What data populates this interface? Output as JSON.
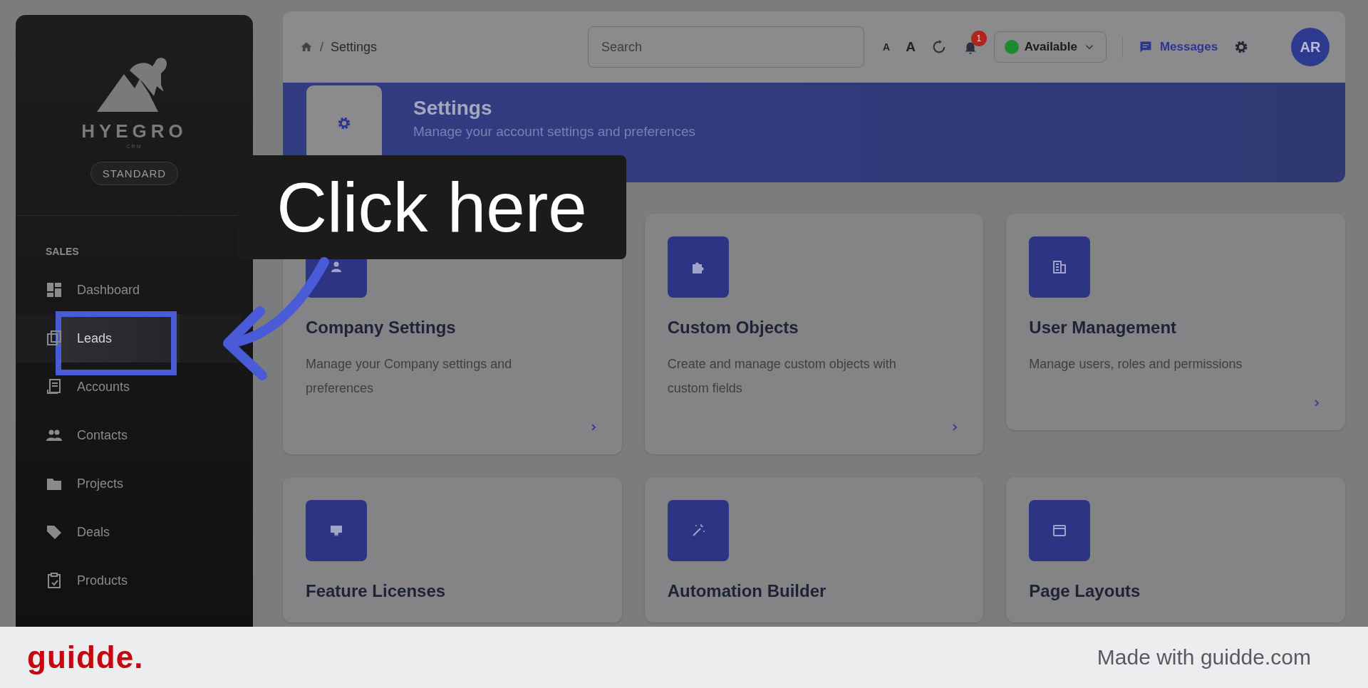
{
  "sidebar": {
    "logo": {
      "name": "HYEGRO",
      "tagline": "CRM"
    },
    "plan": "STANDARD",
    "section": "SALES",
    "items": [
      {
        "label": "Dashboard",
        "selected": false
      },
      {
        "label": "Leads",
        "selected": true
      },
      {
        "label": "Accounts",
        "selected": false
      },
      {
        "label": "Contacts",
        "selected": false
      },
      {
        "label": "Projects",
        "selected": false
      },
      {
        "label": "Deals",
        "selected": false
      },
      {
        "label": "Products",
        "selected": false
      }
    ]
  },
  "header": {
    "breadcrumb": "Settings",
    "separator": "/",
    "search": {
      "placeholder": "Search"
    },
    "font_small": "A",
    "font_large": "A",
    "notifications": "1",
    "status": "Available",
    "messages": "Messages",
    "avatar": "AR"
  },
  "banner": {
    "title": "Settings",
    "subtitle": "Manage your account settings and preferences"
  },
  "cards": [
    {
      "title": "Company Settings",
      "description": "Manage your Company settings and preferences"
    },
    {
      "title": "Custom Objects",
      "description": "Create and manage custom objects with custom fields"
    },
    {
      "title": "User Management",
      "description": "Manage users, roles and permissions"
    },
    {
      "title": "Feature Licenses"
    },
    {
      "title": "Automation Builder"
    },
    {
      "title": "Page Layouts"
    }
  ],
  "tooltip": "Click here",
  "footer": {
    "brand": "guidde.",
    "credit": "Made with guidde.com"
  }
}
